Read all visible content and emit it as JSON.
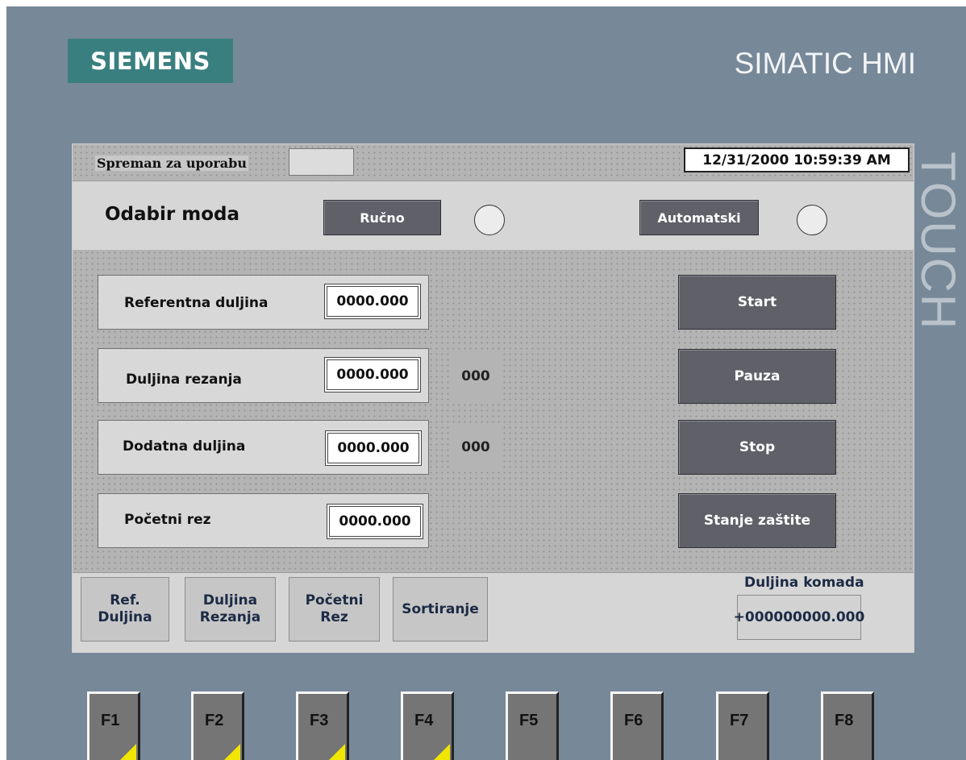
{
  "brand": {
    "logo": "SIEMENS",
    "product": "SIMATIC HMI",
    "side_text": "TOUCH"
  },
  "status_bar": {
    "ready_label": "Spreman za uporabu",
    "datetime": "12/31/2000 10:59:39 AM"
  },
  "mode": {
    "title": "Odabir moda",
    "manual_label": "Ručno",
    "auto_label": "Automatski"
  },
  "parameters": [
    {
      "label": "Referentna duljina",
      "value": "0000.000"
    },
    {
      "label": "Duljina rezanja",
      "value": "0000.000",
      "counter": "000"
    },
    {
      "label": "Dodatna duljina",
      "value": "0000.000",
      "counter": "000"
    },
    {
      "label": "Početni rez",
      "value": "0000.000"
    }
  ],
  "controls": {
    "start": "Start",
    "pause": "Pauza",
    "stop": "Stop",
    "protection": "Stanje zaštite"
  },
  "nav": [
    {
      "line1": "Ref.",
      "line2": "Duljina"
    },
    {
      "line1": "Duljina",
      "line2": "Rezanja"
    },
    {
      "line1": "Početni",
      "line2": "Rez"
    },
    {
      "line1": "Sortiranje",
      "line2": ""
    }
  ],
  "piece": {
    "label": "Duljina komada",
    "value": "+000000000.000"
  },
  "fkeys": [
    "F1",
    "F2",
    "F3",
    "F4",
    "F5",
    "F6",
    "F7",
    "F8"
  ],
  "colors": {
    "frame": "#778899",
    "logo_bg": "#3a7f80",
    "button": "#5f6068",
    "softkey_corner": "#f0e600"
  }
}
